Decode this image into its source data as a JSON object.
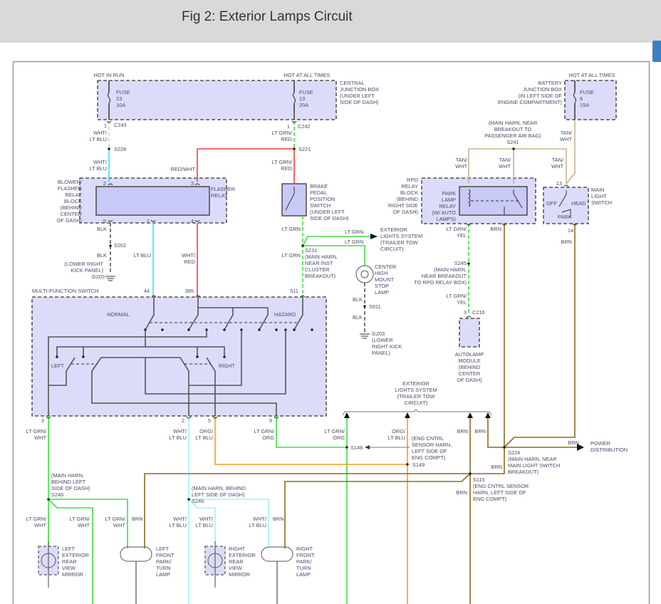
{
  "header": {
    "title": "Fig 2: Exterior Lamps Circuit"
  },
  "colors": {
    "lt_grn": "#3de03d",
    "lt_blu": "#2ee6f0",
    "red": "#ff3b3b",
    "tan": "#c9b48a",
    "brn": "#8c6b1e",
    "org": "#ff9a1a",
    "blk": "#555555",
    "wht_lt_blu": "#a8f0f0",
    "wht": "#cfcfcf",
    "box_fill": "#dcdcfa",
    "inner_fill": "#c9c9f7",
    "text": "#4a4a68"
  },
  "labels": {
    "hot_in_run": [
      "HOT IN RUN"
    ],
    "hot_all_1": [
      "HOT AT ALL TIMES"
    ],
    "central_jb": [
      "CENTRAL",
      "JUNCTION BOX",
      "(UNDER LEFT",
      "SIDE OF DASH)"
    ],
    "fuse23": [
      "FUSE",
      "23",
      "10A"
    ],
    "fuse13": [
      "FUSE",
      "13",
      "20A"
    ],
    "c243": [
      "C243"
    ],
    "c243_pin": [
      "1"
    ],
    "c242": [
      "C242"
    ],
    "c242_pin": [
      "1"
    ],
    "w_whtltblu_1": [
      "WHT/",
      "LT BLU"
    ],
    "s228": [
      "S228"
    ],
    "w_whtltblu_2": [
      "WHT/",
      "LT BLU"
    ],
    "w_redwht": [
      "RED/WHT"
    ],
    "w_ltgrnred_1": [
      "LT GRN/",
      "RED"
    ],
    "s221": [
      "S221"
    ],
    "w_ltgrnred_2": [
      "LT GRN/",
      "RED"
    ],
    "blower_block": [
      "BLOWER/",
      "FLASHER",
      "RELAY",
      "BLOCK",
      "(BEHIND",
      "CENTER",
      "OF DASH)"
    ],
    "flasher_relay": [
      "FLASHER",
      "RELAY"
    ],
    "pin_r2": [
      "2"
    ],
    "pin_r3": [
      "3"
    ],
    "pin_r5": [
      "5"
    ],
    "pin_r1": [
      "1"
    ],
    "pin_r4": [
      "4"
    ],
    "w_blk_1": [
      "BLK"
    ],
    "s202": [
      "S202"
    ],
    "w_blk_2": [
      "BLK"
    ],
    "kick_panel": [
      "(LOWER RIGHT",
      "KICK PANEL)"
    ],
    "g203_a": [
      "G203"
    ],
    "w_ltblu": [
      "LT BLU"
    ],
    "w_whtred": [
      "WHT/",
      "RED"
    ],
    "brake_switch": [
      "BRAKE",
      "PEDAL",
      "POSITION",
      "SWITCH",
      "(UNDER LEFT",
      "SIDE OF DASH)"
    ],
    "w_ltgrn_a": [
      "LT GRN"
    ],
    "w_ltgrn_top": [
      "LT GRN"
    ],
    "w_ltgrn_bot": [
      "LT GRN"
    ],
    "ext_lights_1": [
      "EXTERIOR",
      "LIGHTS SYSTEM",
      "(TRAILER TOW",
      "CIRCUIT)"
    ],
    "w_ltgrn_b": [
      "LT GRN"
    ],
    "s231": [
      "S231",
      "(MAIN HARN,",
      "NEAR INST",
      "CLUSTER",
      "BREAKOUT)"
    ],
    "chmsl": [
      "CENTER",
      "HIGH",
      "MOUNT",
      "STOP",
      "LAMP"
    ],
    "w_blk_3": [
      "BLK"
    ],
    "s911": [
      "S911"
    ],
    "w_blk_4": [
      "BLK"
    ],
    "g203_b": [
      "G203",
      "(LOWER",
      "RIGHT KICK",
      "PANEL)"
    ],
    "mfs": [
      "MULTI-FUNCTION SWITCH"
    ],
    "pin_44": [
      "44"
    ],
    "pin_385": [
      "385"
    ],
    "pin_511": [
      "511"
    ],
    "normal": [
      "NORMAL"
    ],
    "hazard": [
      "HAZARD"
    ],
    "left": [
      "LEFT"
    ],
    "right": [
      "RIGHT"
    ],
    "pin_3": [
      "3"
    ],
    "pin_2": [
      "2"
    ],
    "pin_5": [
      "5"
    ],
    "pin_9": [
      "9"
    ],
    "w_ltgrnwht_1": [
      "LT GRN/",
      "WHT"
    ],
    "w_whtltblu_3": [
      "WHT/",
      "LT BLU"
    ],
    "w_orgltblu_1": [
      "ORG/",
      "LT BLU"
    ],
    "w_ltgrnorg_1": [
      "LT GRN/",
      "ORG"
    ],
    "w_ltgrnorg_2": [
      "LT GRN/",
      "ORG"
    ],
    "w_orgltblu_2": [
      "ORG/",
      "LT BLU"
    ],
    "eng_cntrl": [
      "(ENG CNTRL",
      "SENSOR HARN,",
      "LEFT SIDE OF",
      "ENG COMPT)"
    ],
    "s148": [
      "S148"
    ],
    "s149": [
      "S149"
    ],
    "w_brn_a": [
      "BRN"
    ],
    "w_brn_b": [
      "BRN"
    ],
    "ext_lights_2": [
      "EXTERIOR",
      "LIGHTS SYSTEM",
      "(TRAILER TOW",
      "CIRCUIT)"
    ],
    "w_brn_c": [
      "BRN"
    ],
    "s224": [
      "S224",
      "(MAIN HARN, NEAR",
      "MAIN LIGHT SWITCH",
      "BREAKOUT)"
    ],
    "w_brn_pd": [
      "BRN"
    ],
    "power_dist": [
      "POWER",
      "DISTRIBUTION"
    ],
    "s115": [
      "S115",
      "(ENG CNTRL SENSOR",
      "HARN, LEFT SIDE OF",
      "ENG COMPT)"
    ],
    "w_brn_d": [
      "BRN"
    ],
    "s246_l": [
      "(MAIN HARN,",
      "BEHIND LEFT",
      "SIDE OF DASH)",
      "S246"
    ],
    "s246_r": [
      "(MAIN HARN, BEHIND",
      "LEFT SIDE OF DASH)",
      "S246"
    ],
    "w_b1": [
      "LT GRN/",
      "WHT"
    ],
    "w_b2": [
      "LT GRN/",
      "WHT"
    ],
    "w_b3": [
      "LT GRN/",
      "WHT"
    ],
    "w_b4": [
      "BRN"
    ],
    "w_b5": [
      "WHT/",
      "LT BLU"
    ],
    "w_b6": [
      "WHT/",
      "LT BLU"
    ],
    "w_b7": [
      "WHT/",
      "LT BLU"
    ],
    "w_b8": [
      "BRN"
    ],
    "left_mirror": [
      "LEFT",
      "EXTERIOR",
      "REAR",
      "VIEW",
      "MIRROR"
    ],
    "left_front": [
      "LEFT",
      "FRONT",
      "PARK/",
      "TURN",
      "LAMP"
    ],
    "right_mirror": [
      "RIGHT",
      "EXTERIOR",
      "REAR",
      "VIEW",
      "MIRROR"
    ],
    "right_front": [
      "RIGHT",
      "FRONT",
      "PARK/",
      "TURN",
      "LAMP"
    ],
    "hot_all_2": [
      "HOT AT ALL TIMES"
    ],
    "battery_jb": [
      "BATTERY",
      "JUNCTION BOX",
      "(IN LEFT SIDE OF",
      "ENGINE COMPARTMENT)"
    ],
    "fuse6": [
      "FUSE",
      "6",
      "15A"
    ],
    "s241": [
      "(MAIN HARN, NEAR",
      "BREAKOUT TO",
      "PASSENGER AIR BAG)",
      "S241"
    ],
    "w_tan_1": [
      "TAN/",
      "WHT"
    ],
    "w_tan_2": [
      "TAN/",
      "WHT"
    ],
    "w_tan_3": [
      "TAN/",
      "WHT"
    ],
    "w_tan_4": [
      "TAN/",
      "WHT"
    ],
    "rpo_block": [
      "RPO",
      "RELAY",
      "BLOCK",
      "(BEHIND",
      "RIGHT SIDE",
      "OF DASH)"
    ],
    "park_relay": [
      "PARK",
      "LAMP",
      "RELAY",
      "(W/ AUTO",
      "LAMPS)"
    ],
    "main_light": [
      "MAIN",
      "LIGHT",
      "SWITCH"
    ],
    "pin_13": [
      "13"
    ],
    "pin_14": [
      "14"
    ],
    "off": [
      "OFF"
    ],
    "head": [
      "HEAD"
    ],
    "park": [
      "PARK"
    ],
    "w_ltgrnyel_1": [
      "LT GRN/",
      "YEL"
    ],
    "w_brn_rel": [
      "BRN"
    ],
    "w_brn_ms": [
      "BRN"
    ],
    "s245": [
      "S245",
      "(MAIN HARN,",
      "NEAR BREAKOUT",
      "TO RPO RELAY BOX)"
    ],
    "w_ltgrnyel_2": [
      "LT GRN/",
      "YEL"
    ],
    "c216": [
      "C216"
    ],
    "c216_pin": [
      "3"
    ],
    "autolamp": [
      "AUTOLAMP",
      "MODULE",
      "(BEHIND",
      "CENTER",
      "OF DASH)"
    ]
  }
}
